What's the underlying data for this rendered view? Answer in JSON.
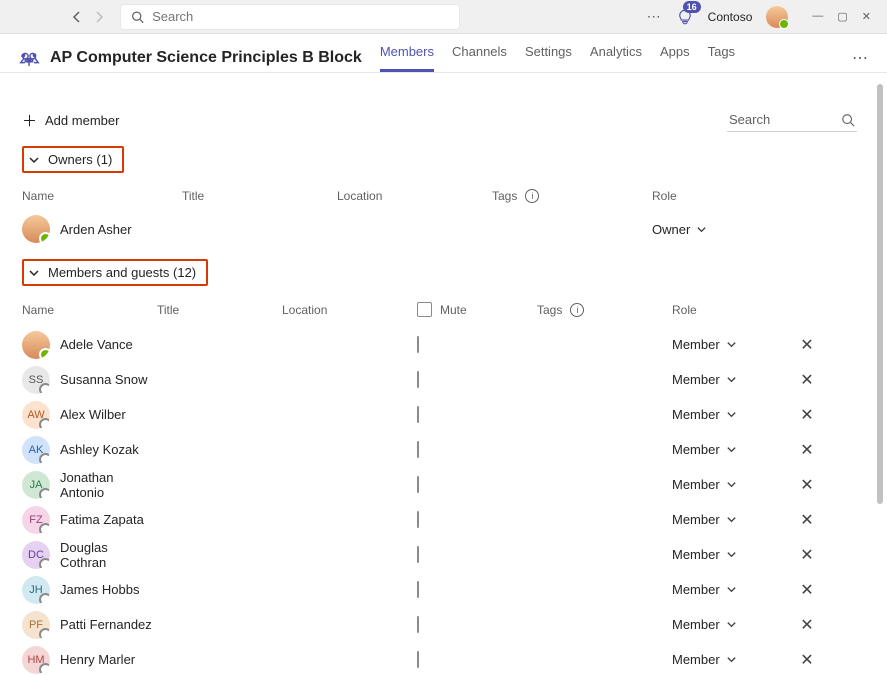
{
  "titlebar": {
    "search_placeholder": "Search",
    "activity_count": "16",
    "org": "Contoso"
  },
  "header": {
    "team_title": "AP Computer Science Principles B Block",
    "tabs": [
      "Members",
      "Channels",
      "Settings",
      "Analytics",
      "Apps",
      "Tags"
    ],
    "active_tab": "Members"
  },
  "toolbar": {
    "add_member_label": "Add member",
    "search_label": "Search"
  },
  "owners_section": {
    "label": "Owners (1)",
    "columns": {
      "name": "Name",
      "title": "Title",
      "location": "Location",
      "tags": "Tags",
      "role": "Role"
    },
    "rows": [
      {
        "name": "Arden Asher",
        "role": "Owner",
        "avatar_class": "photo"
      }
    ]
  },
  "members_section": {
    "label": "Members and guests (12)",
    "columns": {
      "name": "Name",
      "title": "Title",
      "location": "Location",
      "mute": "Mute",
      "tags": "Tags",
      "role": "Role"
    },
    "rows": [
      {
        "name": "Adele Vance",
        "initials": "",
        "avatar_class": "photo",
        "role": "Member",
        "status": "on"
      },
      {
        "name": "Susanna Snow",
        "initials": "SS",
        "avatar_class": "av-ss",
        "role": "Member",
        "status": "off"
      },
      {
        "name": "Alex Wilber",
        "initials": "AW",
        "avatar_class": "av-aw",
        "role": "Member",
        "status": "off"
      },
      {
        "name": "Ashley Kozak",
        "initials": "AK",
        "avatar_class": "av-ak",
        "role": "Member",
        "status": "off"
      },
      {
        "name": "Jonathan Antonio",
        "initials": "JA",
        "avatar_class": "av-ja",
        "role": "Member",
        "status": "off"
      },
      {
        "name": "Fatima Zapata",
        "initials": "FZ",
        "avatar_class": "av-fz",
        "role": "Member",
        "status": "off"
      },
      {
        "name": "Douglas Cothran",
        "initials": "DC",
        "avatar_class": "av-dc",
        "role": "Member",
        "status": "off"
      },
      {
        "name": "James Hobbs",
        "initials": "JH",
        "avatar_class": "av-jh",
        "role": "Member",
        "status": "off"
      },
      {
        "name": "Patti Fernandez",
        "initials": "PF",
        "avatar_class": "av-pf",
        "role": "Member",
        "status": "off"
      },
      {
        "name": "Henry Marler",
        "initials": "HM",
        "avatar_class": "av-hm",
        "role": "Member",
        "status": "off"
      }
    ]
  }
}
